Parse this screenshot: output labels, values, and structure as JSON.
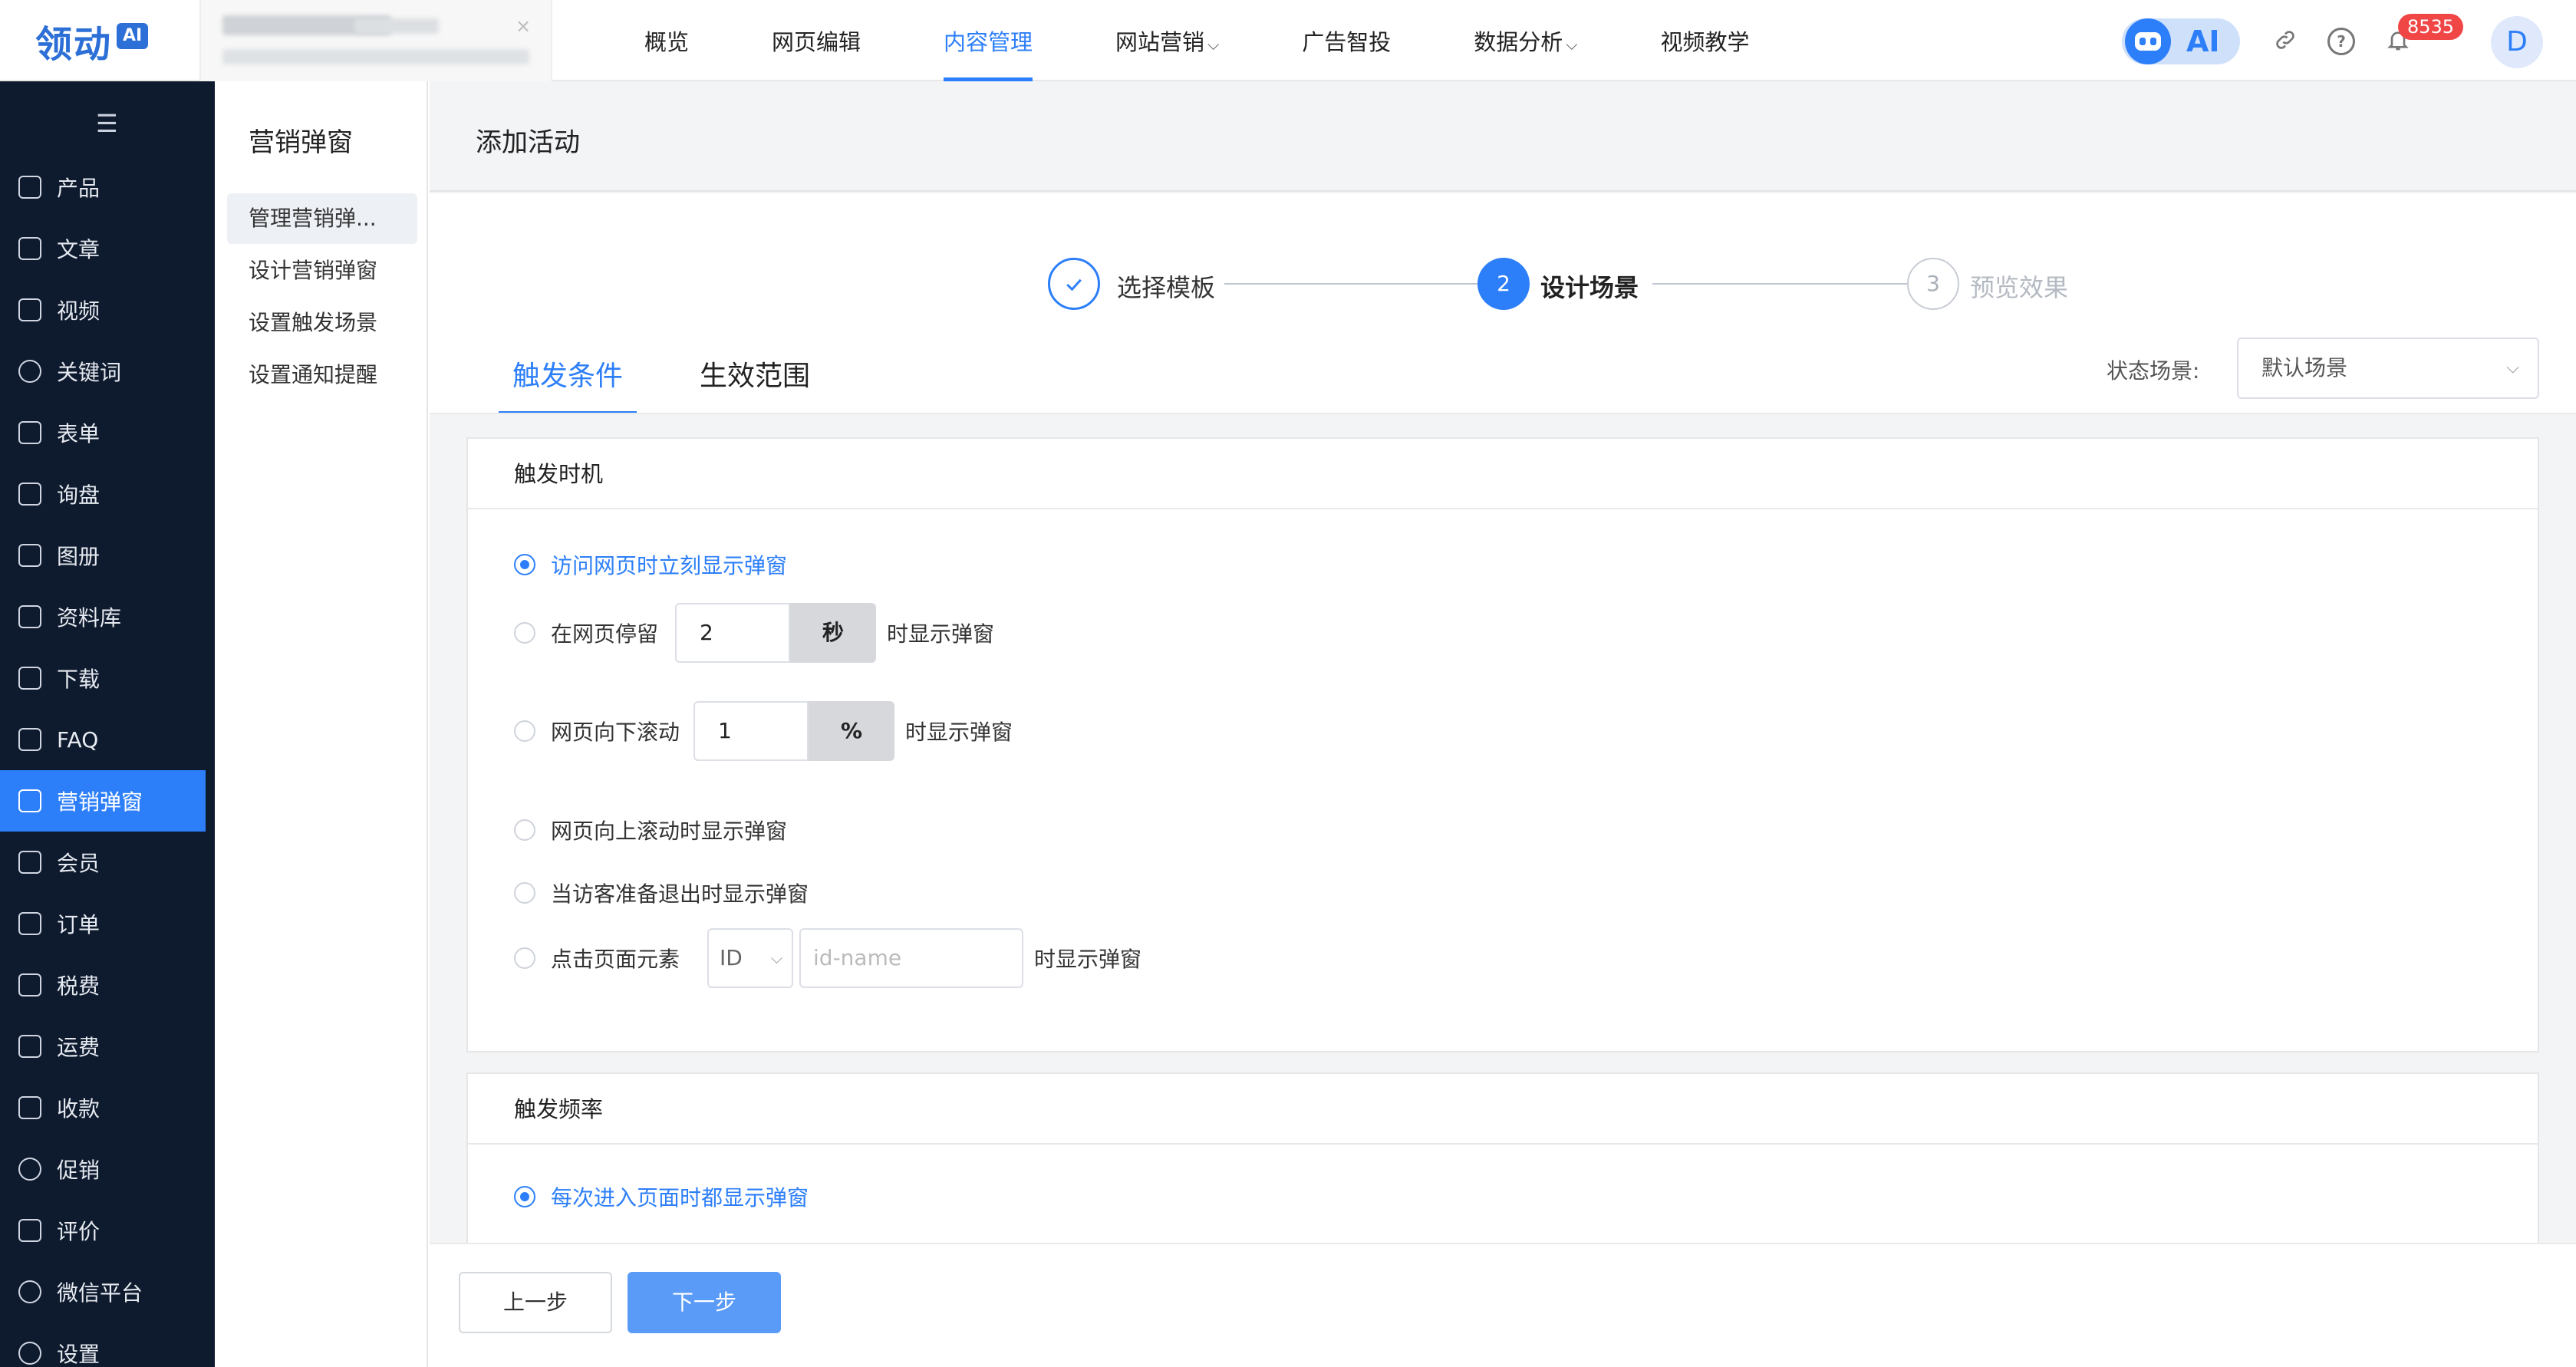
{
  "logo": {
    "text": "领动",
    "badge": "AI"
  },
  "nav": [
    {
      "label": "概览",
      "dropdown": false,
      "active": false
    },
    {
      "label": "网页编辑",
      "dropdown": false,
      "active": false
    },
    {
      "label": "内容管理",
      "dropdown": false,
      "active": true
    },
    {
      "label": "网站营销",
      "dropdown": true,
      "active": false
    },
    {
      "label": "广告智投",
      "dropdown": false,
      "active": false
    },
    {
      "label": "数据分析",
      "dropdown": true,
      "active": false
    },
    {
      "label": "视频教学",
      "dropdown": false,
      "active": false
    }
  ],
  "header_right": {
    "ai_label": "AI",
    "notifications": "8535",
    "avatar_letter": "D"
  },
  "sidebar": {
    "items": [
      {
        "label": "产品",
        "icon": "grid-icon"
      },
      {
        "label": "文章",
        "icon": "document-icon"
      },
      {
        "label": "视频",
        "icon": "video-icon"
      },
      {
        "label": "关键词",
        "icon": "target-icon"
      },
      {
        "label": "表单",
        "icon": "form-icon"
      },
      {
        "label": "询盘",
        "icon": "inquiry-icon"
      },
      {
        "label": "图册",
        "icon": "album-icon"
      },
      {
        "label": "资料库",
        "icon": "database-icon"
      },
      {
        "label": "下载",
        "icon": "download-icon"
      },
      {
        "label": "FAQ",
        "icon": "faq-icon"
      },
      {
        "label": "营销弹窗",
        "icon": "popup-icon",
        "active": true
      },
      {
        "label": "会员",
        "icon": "diamond-icon"
      },
      {
        "label": "订单",
        "icon": "order-icon"
      },
      {
        "label": "税费",
        "icon": "tax-icon"
      },
      {
        "label": "运费",
        "icon": "truck-icon"
      },
      {
        "label": "收款",
        "icon": "wallet-icon"
      },
      {
        "label": "促销",
        "icon": "promotion-icon"
      },
      {
        "label": "评价",
        "icon": "comment-icon"
      },
      {
        "label": "微信平台",
        "icon": "wechat-icon"
      },
      {
        "label": "设置",
        "icon": "settings-icon"
      }
    ]
  },
  "submenu": {
    "title": "营销弹窗",
    "items": [
      {
        "label": "管理营销弹...",
        "active": true
      },
      {
        "label": "设计营销弹窗"
      },
      {
        "label": "设置触发场景"
      },
      {
        "label": "设置通知提醒"
      }
    ]
  },
  "page": {
    "title": "添加活动",
    "steps": [
      {
        "number": "1",
        "label": "选择模板",
        "state": "done"
      },
      {
        "number": "2",
        "label": "设计场景",
        "state": "current"
      },
      {
        "number": "3",
        "label": "预览效果",
        "state": "pending"
      }
    ],
    "tabs": [
      {
        "label": "触发条件",
        "active": true
      },
      {
        "label": "生效范围",
        "active": false
      }
    ],
    "scene": {
      "label": "状态场景:",
      "value": "默认场景"
    },
    "trigger_timing": {
      "title": "触发时机",
      "options": {
        "immediate": "访问网页时立刻显示弹窗",
        "stay_prefix": "在网页停留",
        "stay_value": "2",
        "stay_unit": "秒",
        "stay_suffix": "时显示弹窗",
        "scroll_down_prefix": "网页向下滚动",
        "scroll_down_value": "1",
        "scroll_down_unit": "%",
        "scroll_down_suffix": "时显示弹窗",
        "scroll_up": "网页向上滚动时显示弹窗",
        "exit": "当访客准备退出时显示弹窗",
        "click_prefix": "点击页面元素",
        "click_selector": "ID",
        "click_placeholder": "id-name",
        "click_suffix": "时显示弹窗"
      },
      "selected": "immediate"
    },
    "trigger_frequency": {
      "title": "触发频率",
      "options": {
        "every_visit": "每次进入页面时都显示弹窗"
      },
      "selected": "every_visit"
    },
    "buttons": {
      "prev": "上一步",
      "next": "下一步"
    }
  },
  "colors": {
    "primary": "#2d7ff9",
    "sidebar_bg": "#0e1a2e",
    "badge": "#f04646"
  }
}
